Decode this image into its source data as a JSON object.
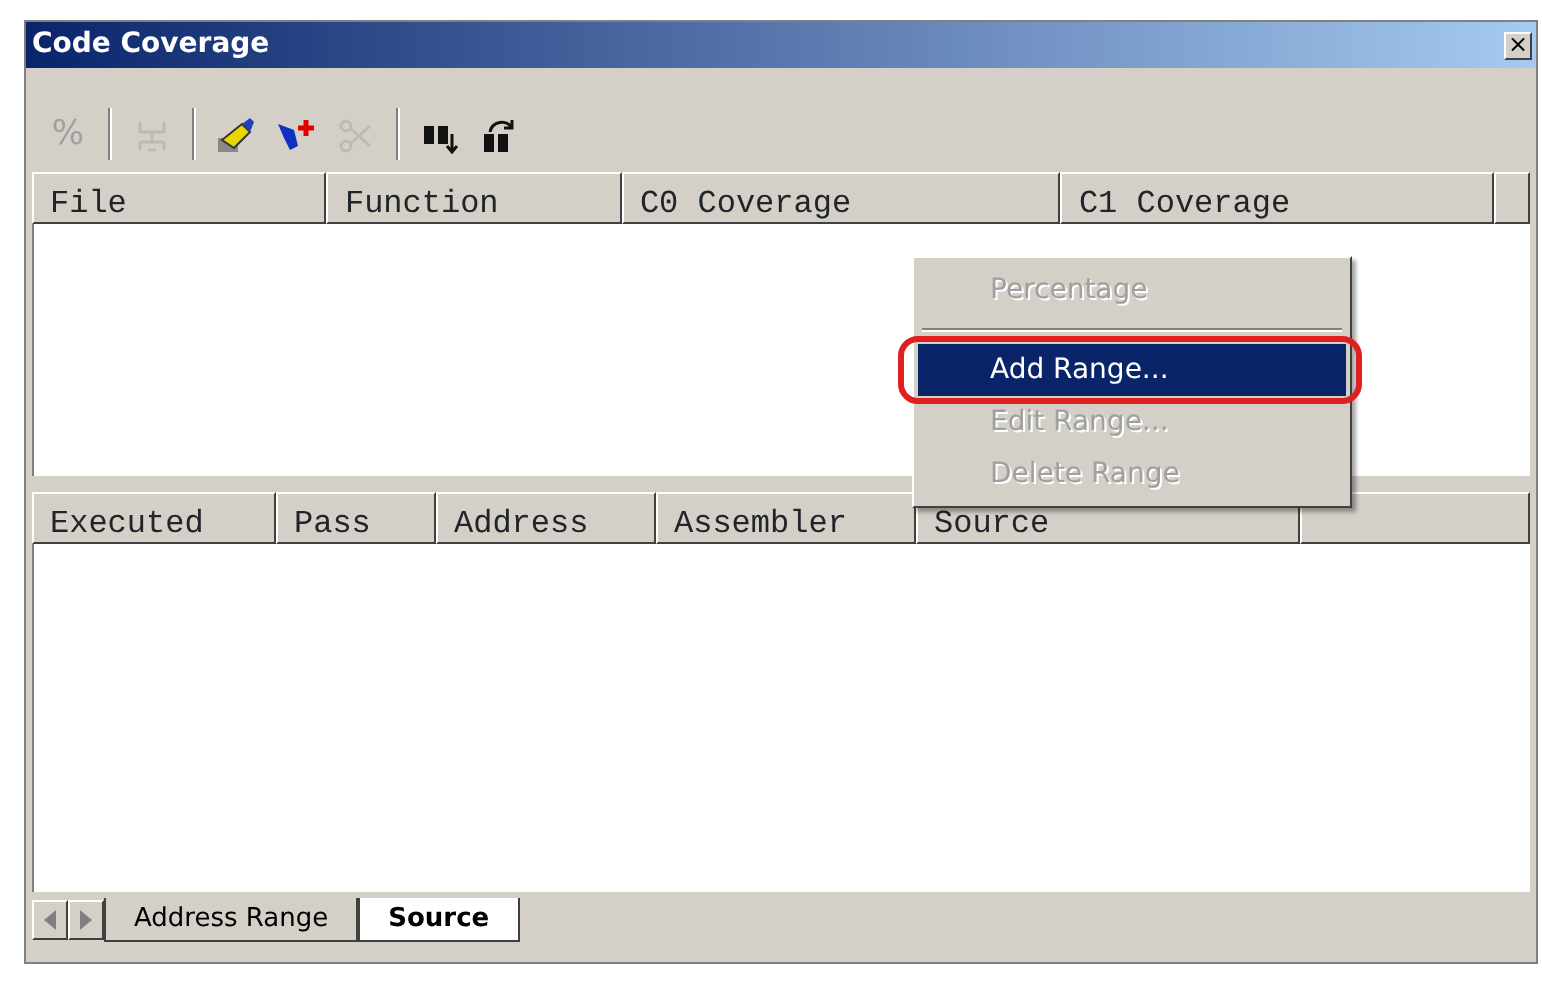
{
  "window": {
    "title": "Code Coverage",
    "close": "×"
  },
  "toolbar": [
    {
      "kind": "percent",
      "label": "%",
      "disabled": true
    },
    {
      "kind": "separator"
    },
    {
      "kind": "network",
      "disabled": true
    },
    {
      "kind": "separator"
    },
    {
      "kind": "brush",
      "disabled": false
    },
    {
      "kind": "pinadd",
      "disabled": false
    },
    {
      "kind": "scissors",
      "disabled": true
    },
    {
      "kind": "separator"
    },
    {
      "kind": "binocularsdown",
      "disabled": false
    },
    {
      "kind": "binocularsrefresh",
      "disabled": false
    }
  ],
  "function_table": {
    "columns": [
      "File",
      "Function",
      "C0 Coverage",
      "C1 Coverage"
    ]
  },
  "code_table": {
    "columns": [
      "Executed",
      "Pass",
      "Address",
      "Assembler",
      "Source"
    ]
  },
  "context_menu": [
    {
      "kind": "item",
      "label": "Percentage",
      "disabled": true,
      "selected": false,
      "circled": false
    },
    {
      "kind": "separator"
    },
    {
      "kind": "item",
      "label": "Add Range...",
      "disabled": false,
      "selected": true,
      "circled": true
    },
    {
      "kind": "item",
      "label": "Edit Range...",
      "disabled": true,
      "selected": false,
      "circled": false
    },
    {
      "kind": "item",
      "label": "Delete Range",
      "disabled": true,
      "selected": false,
      "circled": false
    }
  ],
  "sheet_tabs": [
    {
      "label": "Address Range",
      "selected": false
    },
    {
      "label": "Source",
      "selected": true
    }
  ]
}
